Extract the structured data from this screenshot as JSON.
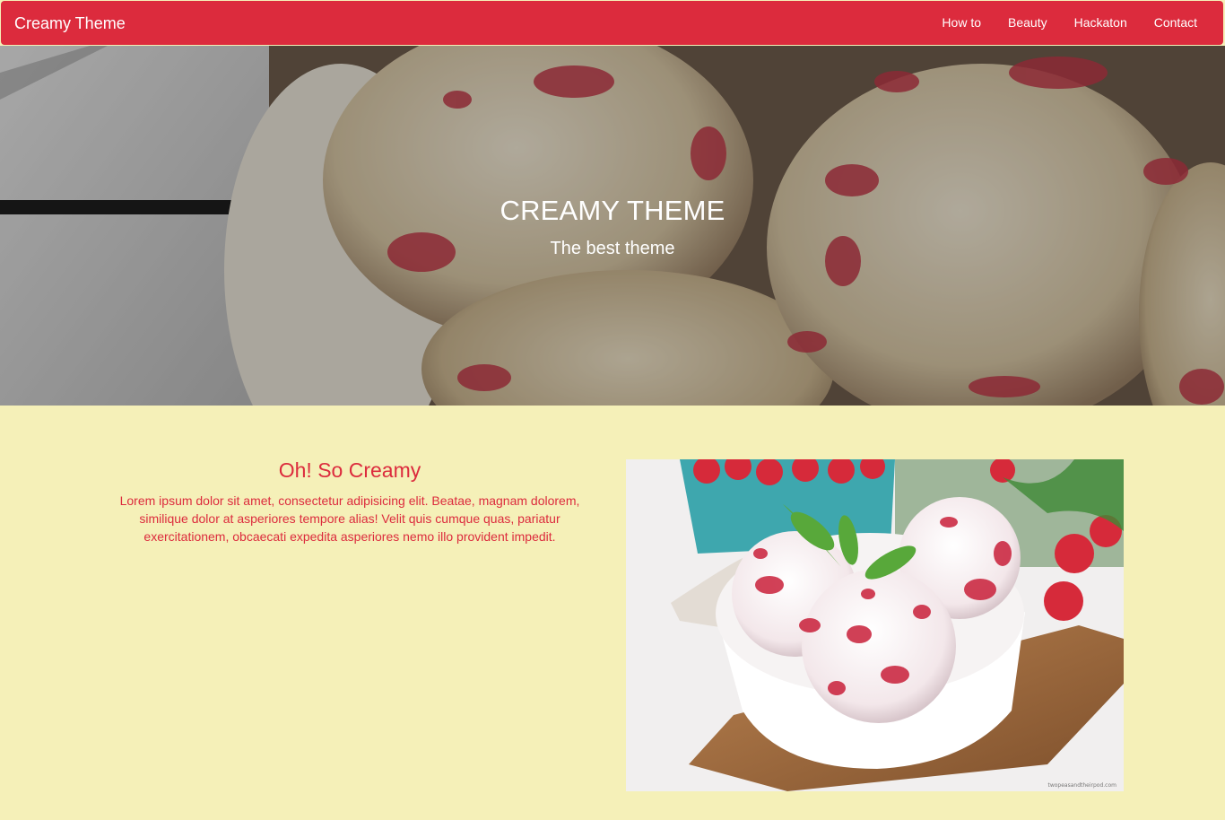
{
  "navbar": {
    "brand": "Creamy Theme",
    "links": [
      "How to",
      "Beauty",
      "Hackaton",
      "Contact"
    ],
    "color": "#dc2b3d"
  },
  "hero": {
    "title": "CREAMY THEME",
    "subtitle": "The best theme"
  },
  "content": {
    "heading": "Oh! So Creamy",
    "text": "Lorem ipsum dolor sit amet, consectetur adipisicing elit. Beatae, magnam dolorem, similique dolor at asperiores tempore alias! Velit quis cumque quas, pariatur exercitationem, obcaecati expedita asperiores nemo illo provident impedit.",
    "photo_credit": "twopeasandtheirpod.com"
  },
  "colors": {
    "accent": "#dc2b3d",
    "background": "#f5f0b8",
    "text_on_accent": "#ffffff"
  }
}
